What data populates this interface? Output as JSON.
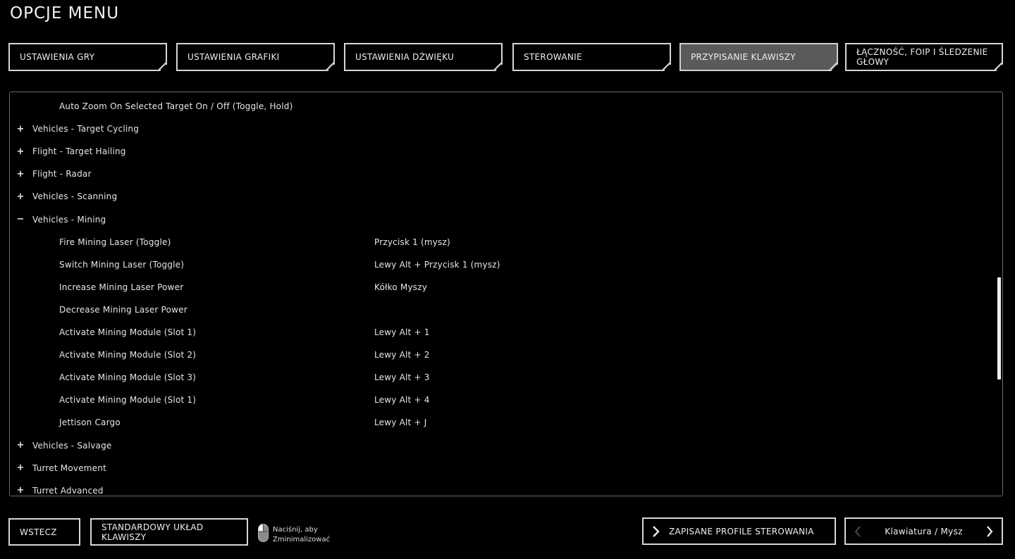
{
  "title": "OPCJE MENU",
  "tabs": [
    {
      "label": "USTAWIENIA GRY",
      "active": false
    },
    {
      "label": "USTAWIENIA GRAFIKI",
      "active": false
    },
    {
      "label": "USTAWIENIA DŹWIĘKU",
      "active": false
    },
    {
      "label": "STEROWANIE",
      "active": false
    },
    {
      "label": "PRZYPISANIE KLAWISZY",
      "active": true
    },
    {
      "label": "ŁĄCZNOŚĆ, FOIP I ŚLEDZENIE GŁOWY",
      "active": false
    }
  ],
  "rows": [
    {
      "type": "item",
      "label": "Auto Zoom On Selected Target On / Off (Toggle, Hold)",
      "binding": ""
    },
    {
      "type": "category",
      "toggle": "+",
      "label": "Vehicles - Target Cycling"
    },
    {
      "type": "category",
      "toggle": "+",
      "label": "Flight - Target Hailing"
    },
    {
      "type": "category",
      "toggle": "+",
      "label": "Flight - Radar"
    },
    {
      "type": "category",
      "toggle": "+",
      "label": "Vehicles - Scanning"
    },
    {
      "type": "category",
      "toggle": "−",
      "label": "Vehicles - Mining"
    },
    {
      "type": "item",
      "label": "Fire Mining Laser (Toggle)",
      "binding": "Przycisk 1 (mysz)"
    },
    {
      "type": "item",
      "label": "Switch Mining Laser (Toggle)",
      "binding": "Lewy Alt + Przycisk 1 (mysz)"
    },
    {
      "type": "item",
      "label": "Increase Mining Laser Power",
      "binding": "Kółko Myszy"
    },
    {
      "type": "item",
      "label": "Decrease Mining Laser Power",
      "binding": ""
    },
    {
      "type": "item",
      "label": "Activate Mining Module (Slot 1)",
      "binding": "Lewy Alt + 1"
    },
    {
      "type": "item",
      "label": "Activate Mining Module (Slot 2)",
      "binding": "Lewy Alt + 2"
    },
    {
      "type": "item",
      "label": "Activate Mining Module (Slot 3)",
      "binding": "Lewy Alt + 3"
    },
    {
      "type": "item",
      "label": "Activate Mining Module (Slot 1)",
      "binding": "Lewy Alt + 4"
    },
    {
      "type": "item",
      "label": "Jettison Cargo",
      "binding": "Lewy Alt + J"
    },
    {
      "type": "category",
      "toggle": "+",
      "label": "Vehicles - Salvage"
    },
    {
      "type": "category",
      "toggle": "+",
      "label": "Turret Movement"
    },
    {
      "type": "category",
      "toggle": "+",
      "label": "Turret Advanced"
    }
  ],
  "footer": {
    "back_label": "WSTECZ",
    "default_layout_label": "STANDARDOWY UKŁAD KLAWISZY",
    "mouse_hint_line1": "Naciśnij, aby",
    "mouse_hint_line2": "Zminimalizować",
    "saved_profiles_label": "ZAPISANE PROFILE STEROWANIA",
    "device_selector_value": "Klawiatura / Mysz"
  },
  "icons": {
    "mouse": "mouse-icon",
    "saved_profiles": "chevron-right-icon",
    "device_prev": "chevron-left-icon",
    "device_next": "chevron-right-icon"
  },
  "colors": {
    "background": "#000000",
    "active_tab": "#5a5a5a",
    "border": "#d6d6d6"
  }
}
